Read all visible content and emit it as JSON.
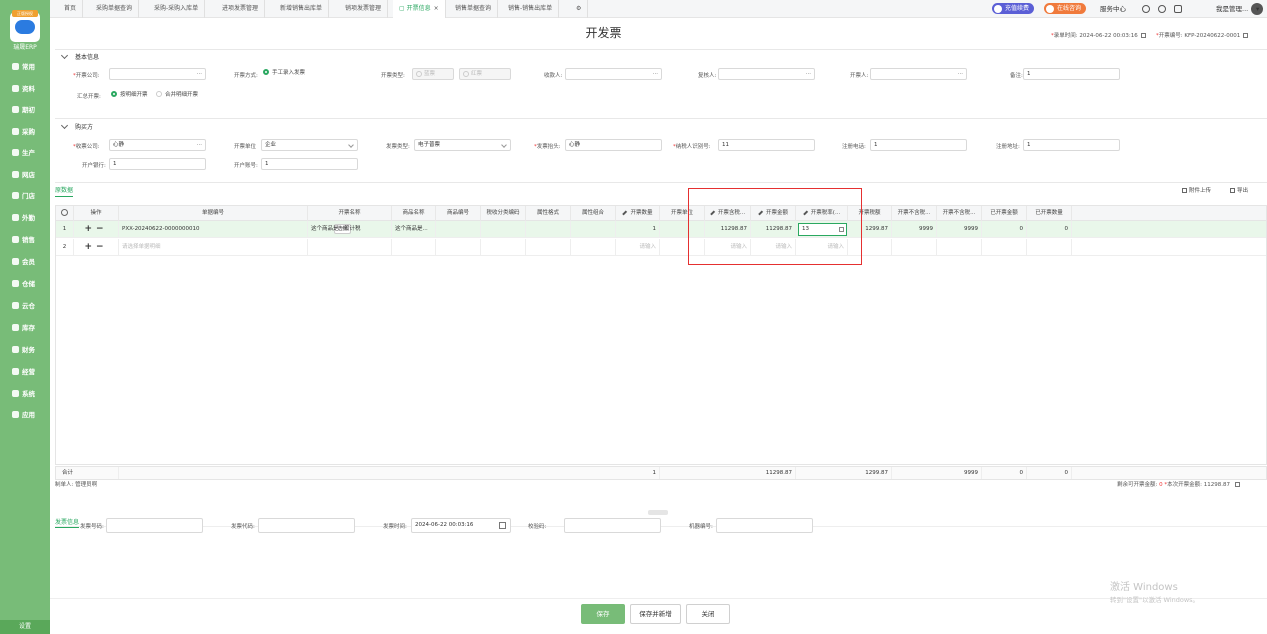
{
  "sidebar": {
    "logo_tag": "正版授权",
    "logo_label": "瑞晟ERP",
    "items": [
      {
        "label": "常用",
        "icon": "star-icon"
      },
      {
        "label": "资料",
        "icon": "book-icon"
      },
      {
        "label": "期初",
        "icon": "clock-icon"
      },
      {
        "label": "采购",
        "icon": "cart-icon"
      },
      {
        "label": "生产",
        "icon": "factory-icon"
      },
      {
        "label": "网店",
        "icon": "store-icon"
      },
      {
        "label": "门店",
        "icon": "shop-icon"
      },
      {
        "label": "外勤",
        "icon": "location-icon"
      },
      {
        "label": "销售",
        "icon": "sales-icon"
      },
      {
        "label": "会员",
        "icon": "member-icon"
      },
      {
        "label": "仓储",
        "icon": "warehouse-icon"
      },
      {
        "label": "云仓",
        "icon": "cloud-icon"
      },
      {
        "label": "库存",
        "icon": "inventory-icon"
      },
      {
        "label": "财务",
        "icon": "finance-icon"
      },
      {
        "label": "经营",
        "icon": "chart-icon"
      },
      {
        "label": "系统",
        "icon": "gear-icon"
      },
      {
        "label": "应用",
        "icon": "apps-icon"
      }
    ],
    "settings": "设置"
  },
  "tabs": [
    {
      "label": "首页"
    },
    {
      "label": "采购单据查询"
    },
    {
      "label": "采购-采购入库单"
    },
    {
      "label": "进项发票管理"
    },
    {
      "label": "新增销售出库单"
    },
    {
      "label": "销项发票管理"
    },
    {
      "label": "开票信息",
      "active": true,
      "close": "×"
    },
    {
      "label": "销售单据查询"
    },
    {
      "label": "销售-销售出库单"
    }
  ],
  "header": {
    "recharge": "充值续费",
    "consult": "在线咨询",
    "service": "服务中心",
    "user": "我是管理..."
  },
  "page": {
    "title": "开发票",
    "entry_time_label": "录单时间:",
    "entry_time": "2024-06-22 00:03:16",
    "invoice_no_label": "开票编号:",
    "invoice_no": "KFP-20240622-0001"
  },
  "basic": {
    "title": "基本信息",
    "issuer_company_label": "开票公司:",
    "issuer_company": "",
    "method_label": "开票方式:",
    "method_option": "手工录入发票",
    "type_label": "开票类型:",
    "type_blue": "蓝票",
    "type_red": "红票",
    "payee_label": "收款人:",
    "payee": "",
    "reviewer_label": "复核人:",
    "reviewer": "",
    "drawer_label": "开票人:",
    "drawer": "",
    "remark_label": "备注:",
    "remark": "1",
    "merge_label": "汇总开票:",
    "merge_by_detail": "按明细开票",
    "merge_combined": "合并明细开票"
  },
  "buyer": {
    "title": "购买方",
    "receiver_company_label": "收票公司:",
    "receiver_company": "心静",
    "unit_label": "开票单位",
    "unit": "企业",
    "invoice_type_label": "发票类型:",
    "invoice_type": "电子普票",
    "header_label": "发票抬头:",
    "header_value": "心静",
    "tax_id_label": "纳税人识别号:",
    "tax_id": "11",
    "phone_label": "注册电话:",
    "phone": "1",
    "address_label": "注册地址:",
    "address": "1",
    "bank_label": "开户银行:",
    "bank": "1",
    "account_label": "开户账号:",
    "account": "1"
  },
  "grid": {
    "tab_label": "原数据",
    "attach_label": "附件上传",
    "export_label": "导出",
    "columns": [
      "操作",
      "单据编号",
      "开票名称",
      "商品名称",
      "商品编号",
      "税收分类编码",
      "属性格式",
      "属性组合",
      "开票数量",
      "开票单位",
      "开票含税...",
      "开票金额",
      "开票税率(...",
      "开票税额",
      "开票不含税...",
      "开票不含税...",
      "已开票金额",
      "已开票数量"
    ],
    "rows": [
      {
        "no": "1",
        "doc": "PXX-20240622-0000000010",
        "choose": "选择",
        "invoice_name": "这个商品是一般计税",
        "goods_name": "这个商品是...",
        "qty": "1",
        "incl_tax_price": "11298.87",
        "amount": "11298.87",
        "tax_rate": "13",
        "tax": "1299.87",
        "excl_price": "9999",
        "excl_amount": "9999",
        "invoiced_amount": "0",
        "invoiced_qty": "0"
      },
      {
        "no": "2",
        "doc_placeholder": "请选择单据明细",
        "qty_placeholder": "请输入",
        "p1": "请输入",
        "p2": "请输入",
        "p3": "请输入"
      }
    ],
    "sum_label": "合计",
    "sum": {
      "qty": "1",
      "amount": "11298.87",
      "tax": "1299.87",
      "excl_amount": "9999",
      "invoiced_amount": "0",
      "invoiced_qty": "0"
    }
  },
  "footer": {
    "maker_label": "制单人:",
    "maker": "管理员啊",
    "remaining_label": "剩余可开票金额:",
    "remaining": "0",
    "this_label": "本次开票金额:",
    "this_amount": "11298.87",
    "invoice_tab": "发票信息",
    "number_label": "发票号码:",
    "code_label": "发票代码:",
    "time_label": "发票时间:",
    "time_value": "2024-06-22 00:03:16",
    "check_label": "校验码:",
    "machine_label": "机器编号:"
  },
  "buttons": {
    "save": "保存",
    "save_new": "保存并新增",
    "close": "关闭"
  },
  "watermark": {
    "line1": "激活 Windows",
    "line2": "转到\"设置\"以激活 Windows。"
  },
  "colors": {
    "accent": "#2aa860",
    "sidebar": "#78bc78",
    "highlight": "#e53030",
    "recharge": "#5b5fd6",
    "consult": "#f07a3c"
  }
}
